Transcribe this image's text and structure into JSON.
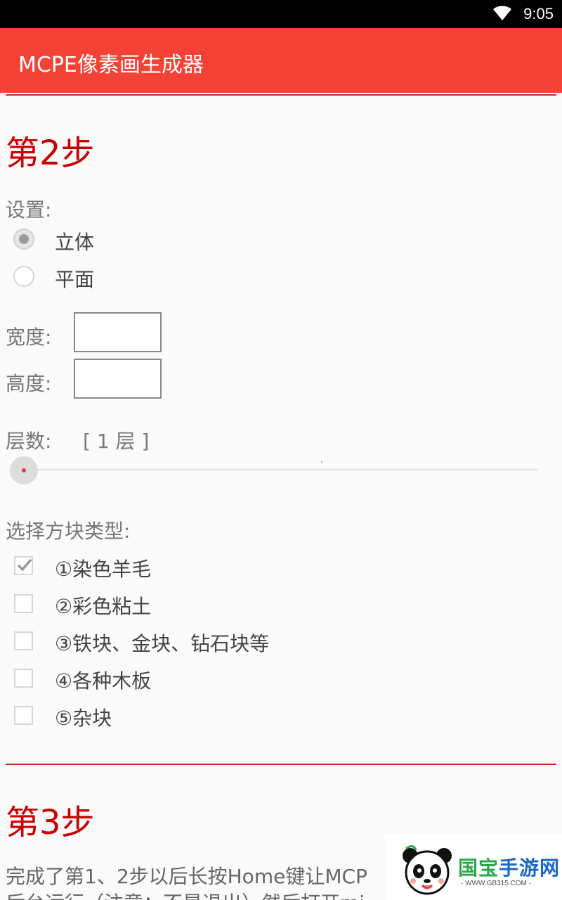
{
  "status_bar": {
    "time": "9:05",
    "wifi_icon": "wifi-icon"
  },
  "app_bar": {
    "title": "MCPE像素画生成器"
  },
  "step2": {
    "title": "第2步",
    "settings_label": "设置:",
    "mode_options": [
      {
        "label": "立体",
        "checked": true
      },
      {
        "label": "平面",
        "checked": false
      }
    ],
    "width_label": "宽度:",
    "width_value": "",
    "height_label": "高度:",
    "height_value": "",
    "layers_label": "层数:",
    "layers_value": "[ 1 层 ]",
    "layers_slider_fraction": 0,
    "block_type_label": "选择方块类型:",
    "block_types": [
      {
        "label": "①染色羊毛",
        "checked": true
      },
      {
        "label": "②彩色粘土",
        "checked": false
      },
      {
        "label": "③铁块、金块、钻石块等",
        "checked": false
      },
      {
        "label": "④各种木板",
        "checked": false
      },
      {
        "label": "⑤杂块",
        "checked": false
      }
    ]
  },
  "step3": {
    "title": "第3步",
    "text_line1": "完成了第1、2步以后长按Home键让MCP",
    "text_line2": "后台运行（注意：不是退出）然后打开mi"
  },
  "watermark": {
    "brand_green": "国宝",
    "brand_blue": "手游网",
    "url": "- WWW.GB315.COM -",
    "colors": {
      "green": "#28a84a",
      "blue": "#1a66c7"
    }
  },
  "colors": {
    "app_bar": "#f44336",
    "accent": "#c00000"
  }
}
